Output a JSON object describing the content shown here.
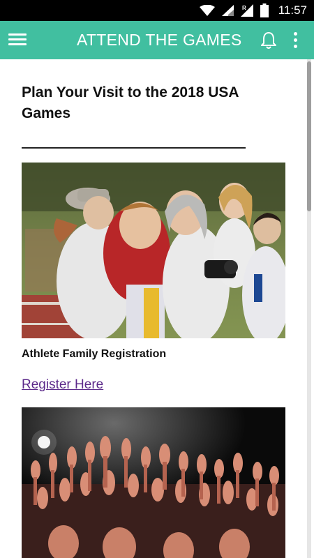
{
  "status_bar": {
    "time": "11:57",
    "icons": [
      "wifi-icon",
      "cell-signal-icon",
      "roaming-signal-icon",
      "battery-icon"
    ]
  },
  "app_bar": {
    "title": "ATTEND THE GAMES",
    "background": "#41bfa0",
    "menu_icon": "hamburger-menu-icon",
    "notification_icon": "bell-icon",
    "overflow_icon": "more-vert-icon"
  },
  "main": {
    "heading": "Plan Your Visit to the 2018 USA Games",
    "rule": "______________________________",
    "sections": [
      {
        "image": "athlete-family-hug-photo",
        "caption": "Athlete Family Registration",
        "link_label": "Register Here"
      },
      {
        "image": "cheering-crowd-photo"
      }
    ]
  },
  "colors": {
    "accent": "#41bfa0",
    "link": "#5c2a8a",
    "status_bar": "#000000"
  }
}
